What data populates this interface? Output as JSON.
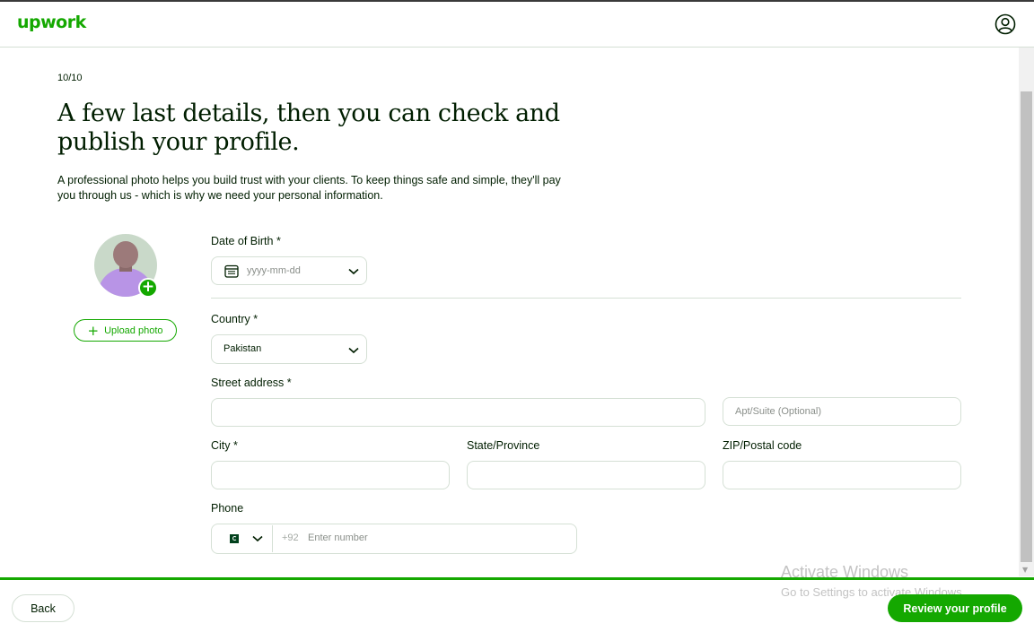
{
  "header": {
    "logo": "upwork"
  },
  "page": {
    "step": "10/10",
    "title": "A few last details, then you can check and publish your profile.",
    "subtitle": "A professional photo helps you build trust with your clients. To keep things safe and simple, they'll pay you through us - which is why we need your personal information."
  },
  "photo": {
    "upload_label": "Upload photo"
  },
  "form": {
    "dob": {
      "label": "Date of Birth *",
      "placeholder": "yyyy-mm-dd"
    },
    "country": {
      "label": "Country *",
      "value": "Pakistan"
    },
    "street": {
      "label": "Street address *",
      "value": "",
      "apt_placeholder": "Apt/Suite (Optional)"
    },
    "city": {
      "label": "City *",
      "value": ""
    },
    "state": {
      "label": "State/Province",
      "value": ""
    },
    "zip": {
      "label": "ZIP/Postal code",
      "value": ""
    },
    "phone": {
      "label": "Phone",
      "country_code": "+92",
      "placeholder": "Enter number"
    }
  },
  "footer": {
    "back_label": "Back",
    "review_label": "Review your profile"
  },
  "watermark": {
    "line1": "Activate Windows",
    "line2": "Go to Settings to activate Windows."
  },
  "colors": {
    "brand": "#14a800",
    "text": "#001e00",
    "border": "#d5e0d5"
  }
}
